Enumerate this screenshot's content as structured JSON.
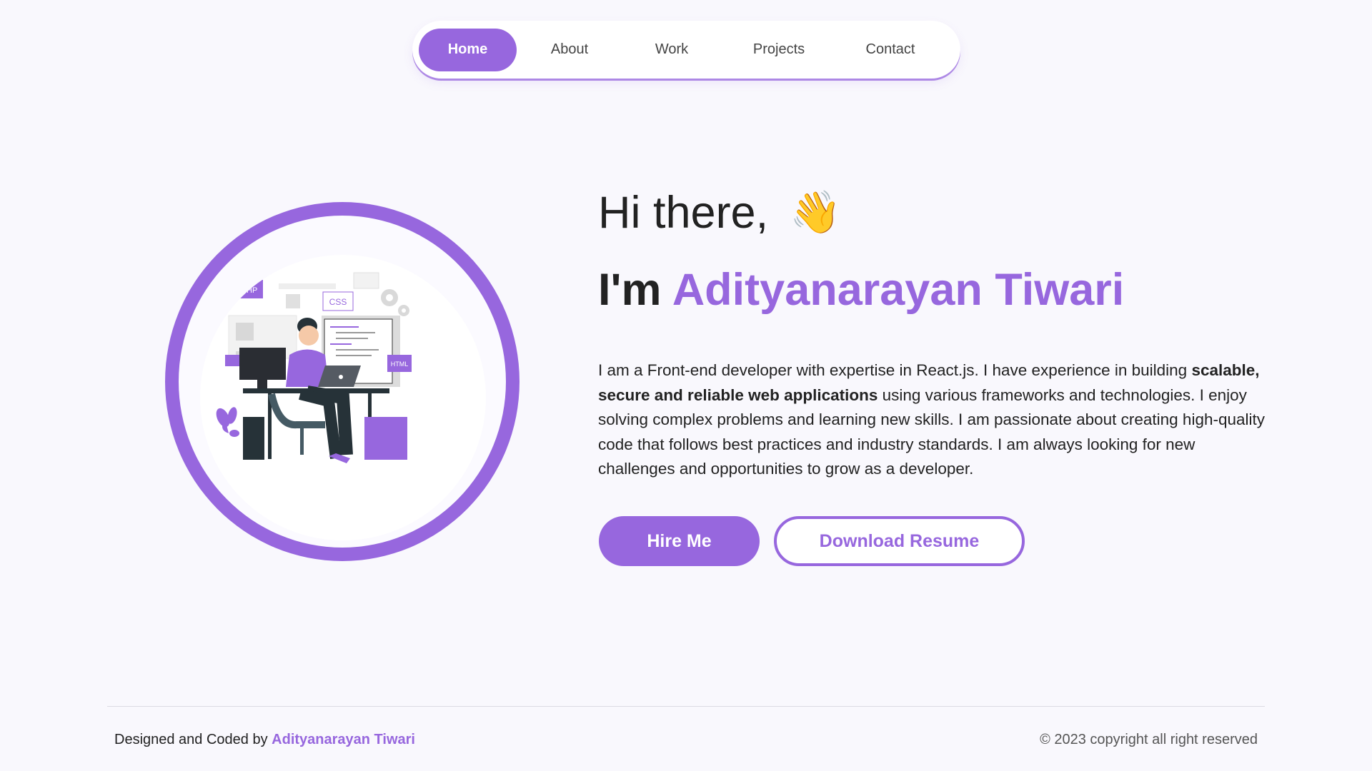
{
  "nav": {
    "items": [
      {
        "label": "Home",
        "active": true
      },
      {
        "label": "About"
      },
      {
        "label": "Work"
      },
      {
        "label": "Projects"
      },
      {
        "label": "Contact"
      }
    ]
  },
  "hero": {
    "illustration_tags": {
      "php": "PHP",
      "css": "CSS",
      "html": "HTML"
    },
    "greeting": "Hi there,",
    "wave_emoji": "👋",
    "intro_prefix": "I'm",
    "name": "Adityanarayan Tiwari",
    "description": {
      "part1": "I am a Front-end developer with expertise in React.js. I have experience in building ",
      "bold": "scalable, secure and reliable web applications",
      "part2": " using various frameworks and technologies. I enjoy solving complex problems and learning new skills. I am passionate about creating high-quality code that follows best practices and industry standards. I am always looking for new challenges and opportunities to grow as a developer."
    },
    "buttons": {
      "hire": "Hire Me",
      "resume": "Download Resume"
    }
  },
  "footer": {
    "left_prefix": "Designed and Coded by",
    "left_name": "Adityanarayan Tiwari",
    "right": "© 2023 copyright all right reserved"
  },
  "colors": {
    "accent": "#9767de",
    "background": "#f9f8fd"
  }
}
